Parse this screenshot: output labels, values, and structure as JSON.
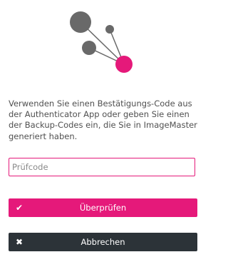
{
  "logo": {
    "icon": "molecule-logo-icon",
    "colors": {
      "gray": "#696969",
      "accent": "#e5197a"
    }
  },
  "description": "Verwenden Sie einen Bestätigungs-Code aus der Authenticator App oder geben Sie einen der Backup-Codes ein, die Sie in ImageMaster generiert haben.",
  "code_input": {
    "value": "",
    "placeholder": "Prüfcode"
  },
  "verify_button": {
    "label": "Überprüfen",
    "icon": "check-icon",
    "color": "#e5197a"
  },
  "cancel_button": {
    "label": "Abbrechen",
    "icon": "close-icon",
    "color": "#2c3338"
  }
}
